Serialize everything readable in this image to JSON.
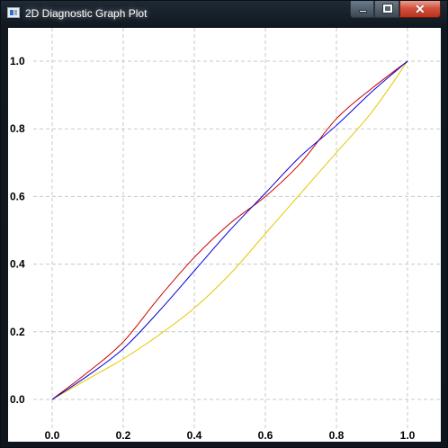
{
  "window": {
    "title": "2D Diagnostic Graph Plot",
    "controls": {
      "minimize": "minimize",
      "maximize": "maximize",
      "close": "✕"
    }
  },
  "colors": {
    "grid": "#c8c8c8",
    "red_series": "#cc0000",
    "blue_series": "#0000dd",
    "yellow_series": "#e6c800",
    "close_button": "#c8412c"
  },
  "chart_data": {
    "type": "line",
    "title": "",
    "xlabel": "",
    "ylabel": "",
    "xlim": [
      0.0,
      1.0
    ],
    "ylim": [
      0.0,
      1.0
    ],
    "grid": true,
    "grid_style": "dashed",
    "x_ticks": [
      "0.0",
      "0.2",
      "0.4",
      "0.6",
      "0.8",
      "1.0"
    ],
    "y_ticks": [
      "0.0",
      "0.2",
      "0.4",
      "0.6",
      "0.8",
      "1.0"
    ],
    "series": [
      {
        "color": "#cc0000",
        "x": [
          0.0,
          0.1,
          0.2,
          0.3,
          0.4,
          0.5,
          0.6,
          0.7,
          0.8,
          0.9,
          1.0
        ],
        "y": [
          0.0,
          0.08,
          0.17,
          0.3,
          0.42,
          0.52,
          0.6,
          0.7,
          0.83,
          0.92,
          1.0
        ]
      },
      {
        "color": "#0000dd",
        "x": [
          0.0,
          0.1,
          0.2,
          0.3,
          0.4,
          0.5,
          0.6,
          0.7,
          0.8,
          0.9,
          1.0
        ],
        "y": [
          0.0,
          0.07,
          0.15,
          0.26,
          0.38,
          0.5,
          0.61,
          0.72,
          0.81,
          0.91,
          1.0
        ]
      },
      {
        "color": "#e6c800",
        "x": [
          0.0,
          0.1,
          0.2,
          0.3,
          0.4,
          0.5,
          0.6,
          0.7,
          0.8,
          0.9,
          1.0
        ],
        "y": [
          0.0,
          0.06,
          0.12,
          0.19,
          0.27,
          0.37,
          0.49,
          0.61,
          0.73,
          0.85,
          1.0
        ]
      }
    ]
  }
}
